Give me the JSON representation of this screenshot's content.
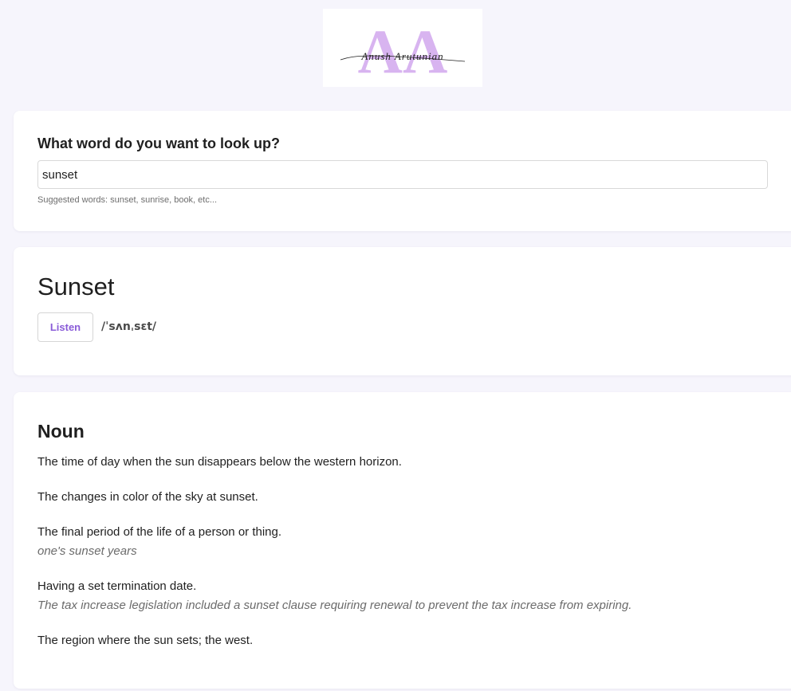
{
  "logo": {
    "monogram": "AA",
    "signature": "Anush Arutunian",
    "monogram_color": "#d8b4f0"
  },
  "search": {
    "title": "What word do you want to look up?",
    "value": "sunset",
    "hint": "Suggested words: sunset, sunrise, book, etc..."
  },
  "word": {
    "title": "Sunset",
    "listen_label": "Listen",
    "phonetic": "/ˈsʌnˌsɛt/",
    "accent_color": "#8a5cd8"
  },
  "meanings": {
    "part_of_speech": "Noun",
    "definitions": [
      {
        "text": "The time of day when the sun disappears below the western horizon.",
        "example": ""
      },
      {
        "text": "The changes in color of the sky at sunset.",
        "example": ""
      },
      {
        "text": "The final period of the life of a person or thing.",
        "example": "one's sunset years"
      },
      {
        "text": "Having a set termination date.",
        "example": "The tax increase legislation included a sunset clause requiring renewal to prevent the tax increase from expiring."
      },
      {
        "text": "The region where the sun sets; the west.",
        "example": ""
      }
    ]
  }
}
